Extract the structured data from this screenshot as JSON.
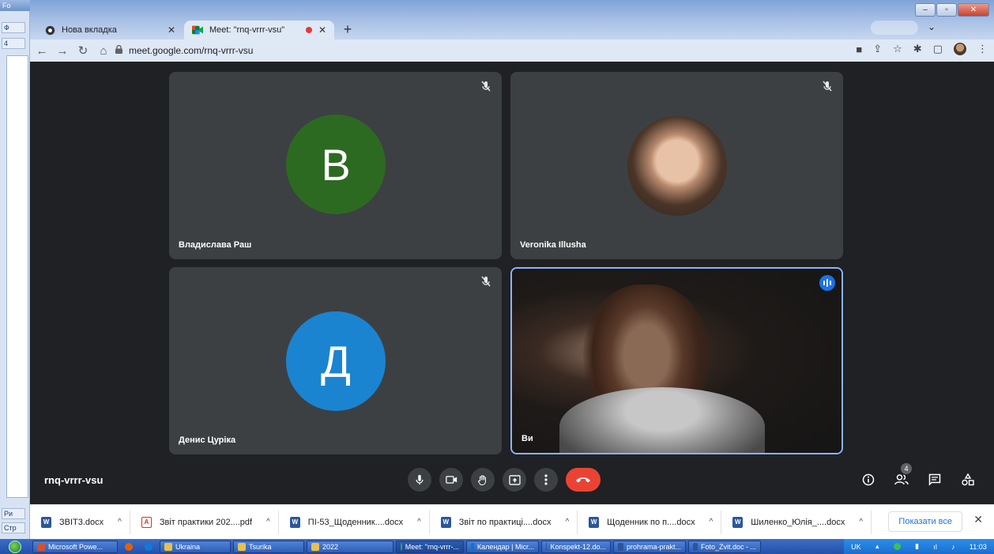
{
  "background_app": {
    "title": "Fo",
    "side_buttons": [
      "Ф",
      "4",
      "Ри",
      "Стр"
    ]
  },
  "browser": {
    "tabs": [
      {
        "title": "Нова вкладка",
        "active": false
      },
      {
        "title": "Meet: \"rnq-vrrr-vsu\"",
        "active": true
      }
    ],
    "url": "meet.google.com/rnq-vrrr-vsu"
  },
  "meet": {
    "participants": [
      {
        "name": "Владислава Раш",
        "initial": "В",
        "color": "#2d6a21",
        "muted": true
      },
      {
        "name": "Veronika Illusha",
        "initial": "",
        "color": "#5b4a3f",
        "muted": true
      },
      {
        "name": "Денис Цурiка",
        "initial": "Д",
        "color": "#1a84d1",
        "muted": true
      },
      {
        "name": "Ви",
        "initial": "",
        "color": "",
        "muted": false
      }
    ],
    "meeting_code": "rnq-vrrr-vsu",
    "people_count": "4"
  },
  "downloads": {
    "items": [
      {
        "name": "ЗВІТ3.docx",
        "type": "word"
      },
      {
        "name": "Звіт практики 202....pdf",
        "type": "pdf"
      },
      {
        "name": "ПІ-53_Щоденник....docx",
        "type": "word"
      },
      {
        "name": "Звіт по практиці....docx",
        "type": "word"
      },
      {
        "name": "Щоденник по п....docx",
        "type": "word"
      },
      {
        "name": "Шиленко_Юлія_....docx",
        "type": "word"
      }
    ],
    "show_all_label": "Показати все"
  },
  "taskbar": {
    "items": [
      {
        "label": "Microsoft Powe...",
        "color": "#d35230"
      },
      {
        "label": "",
        "color": "#e66000"
      },
      {
        "label": "",
        "color": "#0f7bd8"
      },
      {
        "label": "Ukraina",
        "color": "#e8c14a"
      },
      {
        "label": "Tsurika",
        "color": "#e8c14a"
      },
      {
        "label": "2022",
        "color": "#e8c14a"
      },
      {
        "label": "Meet: \"rnq-vrrr-...",
        "color": "#34a853"
      },
      {
        "label": "Календар | Micr...",
        "color": "#0078d4"
      },
      {
        "label": "Konspekt-12.do...",
        "color": "#2b579a"
      },
      {
        "label": "prohrama-prakt...",
        "color": "#2b579a"
      },
      {
        "label": "Foto_Zvit.doc - ...",
        "color": "#2b579a"
      }
    ],
    "language": "UK",
    "time": "11:03"
  }
}
